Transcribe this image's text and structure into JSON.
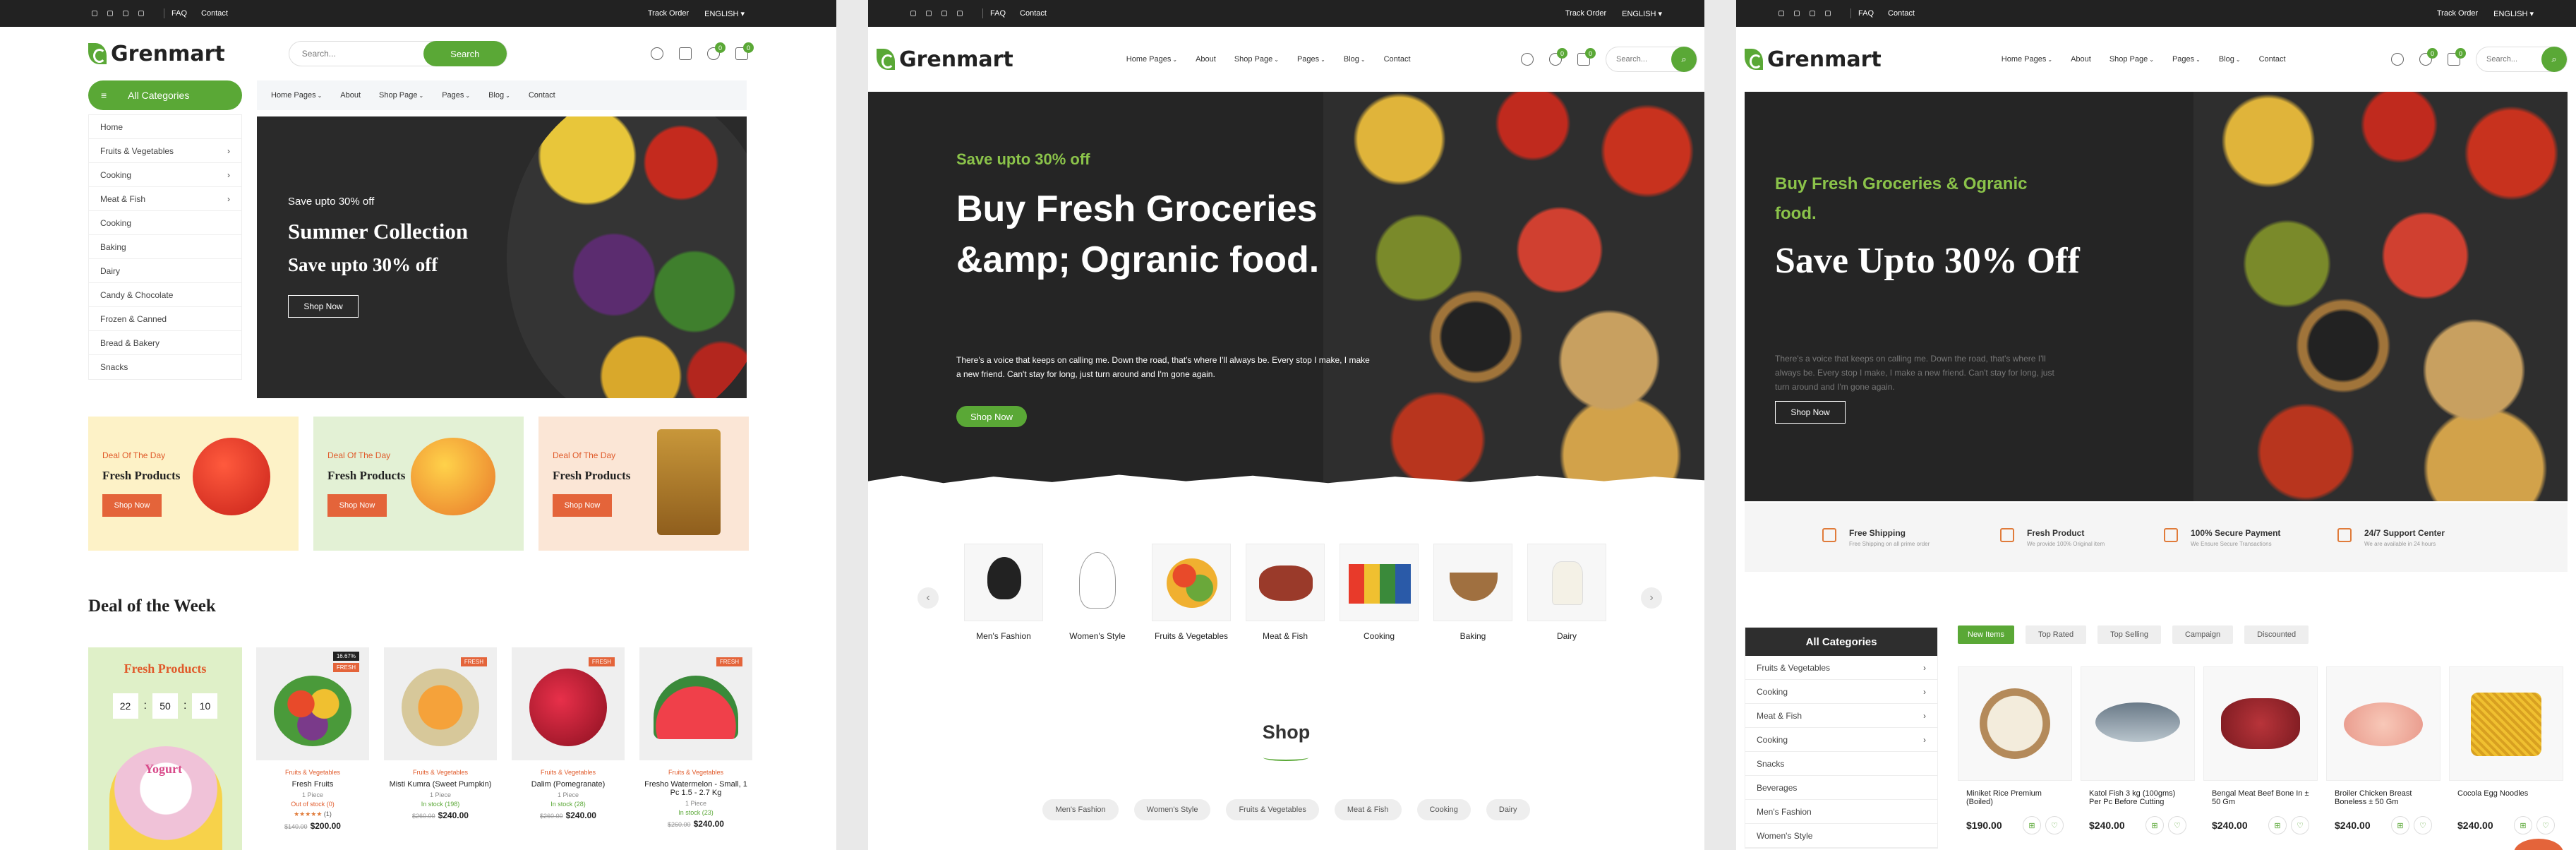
{
  "topbar": {
    "faq": "FAQ",
    "contact": "Contact",
    "track": "Track Order",
    "lang": "ENGLISH"
  },
  "brand": {
    "name": "Grenmart",
    "accent": "#5aa836",
    "orange": "#e4643a"
  },
  "p1": {
    "search_placeholder": "Search...",
    "search_btn": "Search",
    "badges": [
      "0",
      "0"
    ],
    "all_categories": "All Categories",
    "nav": [
      "Home Pages",
      "About",
      "Shop Page",
      "Pages",
      "Blog",
      "Contact"
    ],
    "sidebar": [
      "Home",
      "Fruits & Vegetables",
      "Cooking",
      "Meat & Fish",
      "Cooking",
      "Baking",
      "Dairy",
      "Candy & Chocolate",
      "Frozen & Canned",
      "Bread & Bakery",
      "Snacks"
    ],
    "hero": {
      "pre": "Save upto 30% off",
      "title": "Summer Collection",
      "sub": "Save upto 30% off",
      "btn": "Shop Now"
    },
    "deals": [
      {
        "label": "Deal Of The Day",
        "title": "Fresh Products",
        "btn": "Shop Now"
      },
      {
        "label": "Deal Of The Day",
        "title": "Fresh Products",
        "btn": "Shop Now"
      },
      {
        "label": "Deal Of The Day",
        "title": "Fresh Products",
        "btn": "Shop Now"
      }
    ],
    "deal_week": "Deal of the Week",
    "promo": {
      "title": "Fresh Products",
      "h": "22",
      "m": "50",
      "s": "10",
      "yogurt": "Yogurt"
    },
    "products": [
      {
        "tag": "FRESH",
        "tag2": "16.67%",
        "cat": "Fruits & Vegetables",
        "name": "Fresh Fruits",
        "qty": "1 Piece",
        "stock": "Out of stock (0)",
        "reviews": "(1)",
        "old": "$140.00",
        "price": "$200.00"
      },
      {
        "tag": "FRESH",
        "cat": "Fruits & Vegetables",
        "name": "Misti Kumra (Sweet Pumpkin)",
        "qty": "1 Piece",
        "stock": "In stock (198)",
        "old": "$260.00",
        "price": "$240.00"
      },
      {
        "tag": "FRESH",
        "cat": "Fruits & Vegetables",
        "name": "Dalim (Pomegranate)",
        "qty": "1 Piece",
        "stock": "In stock (28)",
        "old": "$260.00",
        "price": "$240.00"
      },
      {
        "tag": "FRESH",
        "cat": "Fruits & Vegetables",
        "name": "Fresho Watermelon - Small, 1 Pc 1.5 - 2.7 Kg",
        "qty": "1 Piece",
        "stock": "In stock (23)",
        "old": "$260.00",
        "price": "$240.00"
      }
    ]
  },
  "p2": {
    "nav": [
      "Home Pages",
      "About",
      "Shop Page",
      "Pages",
      "Blog",
      "Contact"
    ],
    "search_placeholder": "Search...",
    "badges": [
      "0",
      "0"
    ],
    "hero": {
      "pre": "Save upto 30% off",
      "title": "Buy Fresh Groceries &amp; Ogranic food.",
      "desc": "There's a voice that keeps on calling me. Down the road, that's where I'll always be. Every stop I make, I make a new friend. Can't stay for long, just turn around and I'm gone again.",
      "btn": "Shop Now"
    },
    "categories": [
      "Men's Fashion",
      "Women's Style",
      "Fruits & Vegetables",
      "Meat & Fish",
      "Cooking",
      "Baking",
      "Dairy"
    ],
    "shop_title": "Shop",
    "pills": [
      "Men's Fashion",
      "Women's Style",
      "Fruits & Vegetables",
      "Meat & Fish",
      "Cooking",
      "Dairy"
    ]
  },
  "p3": {
    "nav": [
      "Home Pages",
      "About",
      "Shop Page",
      "Pages",
      "Blog",
      "Contact"
    ],
    "search_placeholder": "Search...",
    "badges": [
      "0",
      "0"
    ],
    "hero": {
      "pre": "Buy Fresh Groceries & Ogranic food.",
      "title": "Save Upto 30% Off",
      "desc": "There's a voice that keeps on calling me. Down the road, that's where I'll always be. Every stop I make, I make a new friend. Can't stay for long, just turn around and I'm gone again.",
      "btn": "Shop Now"
    },
    "features": [
      {
        "t": "Free Shipping",
        "s": "Free Shipping on all prime order"
      },
      {
        "t": "Fresh Product",
        "s": "We provide 100% Original item"
      },
      {
        "t": "100% Secure Payment",
        "s": "We Ensure Secure Transactions"
      },
      {
        "t": "24/7 Support Center",
        "s": "We are available in 24 hours"
      }
    ],
    "all_categories": "All Categories",
    "sidebar": [
      "Fruits & Vegetables",
      "Cooking",
      "Meat & Fish",
      "Cooking",
      "Snacks",
      "Beverages",
      "Men's Fashion",
      "Women's Style"
    ],
    "tabs": [
      "New Items",
      "Top Rated",
      "Top Selling",
      "Campaign",
      "Discounted"
    ],
    "products": [
      {
        "name": "Miniket Rice Premium (Boiled)",
        "price": "$190.00"
      },
      {
        "name": "Katol Fish 3 kg (100gms) Per Pc Before Cutting",
        "price": "$240.00"
      },
      {
        "name": "Bengal Meat Beef Bone In ± 50 Gm",
        "price": "$240.00"
      },
      {
        "name": "Broiler Chicken Breast Boneless ± 50 Gm",
        "price": "$240.00"
      },
      {
        "name": "Cocola Egg Noodles",
        "price": "$240.00"
      }
    ]
  }
}
